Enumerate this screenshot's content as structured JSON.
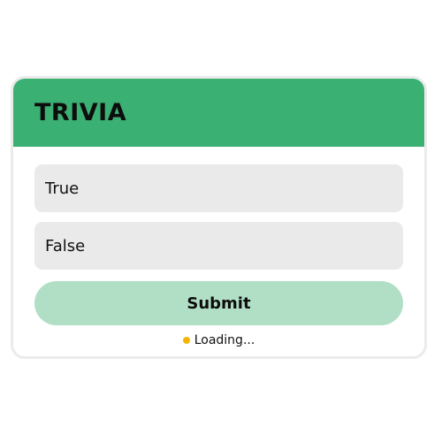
{
  "quiz": {
    "title": "TRIVIA",
    "options": [
      {
        "label": "True"
      },
      {
        "label": "False"
      }
    ],
    "submit_label": "Submit",
    "status_text": "Loading...",
    "status_icon": "loading-dot-icon"
  },
  "colors": {
    "header": "#3bb073",
    "option_background": "#eaeaea",
    "submit_background": "#b1dfc6",
    "status_dot": "#f5b400",
    "card_border": "#ebebeb"
  }
}
